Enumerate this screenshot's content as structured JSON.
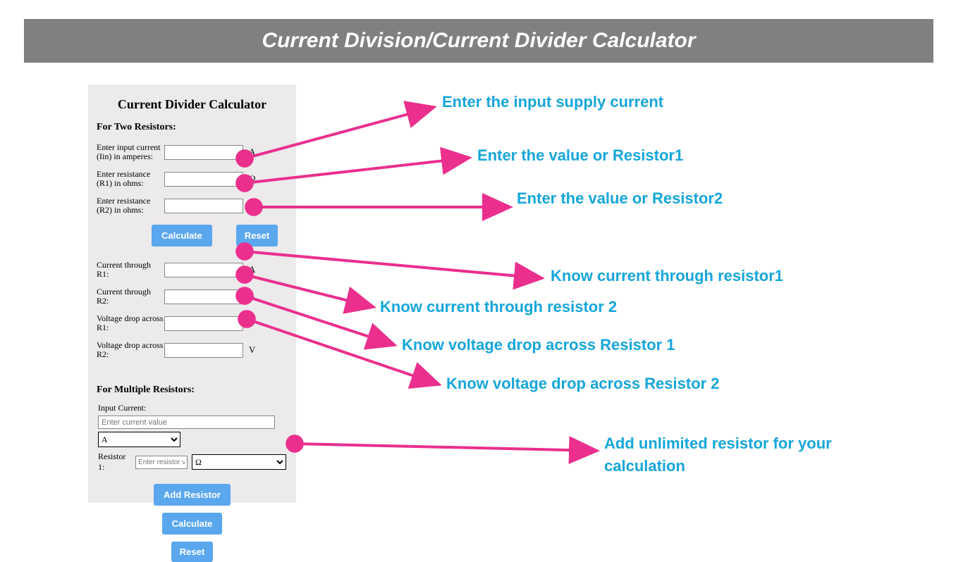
{
  "banner_title": "Current Division/Current Divider Calculator",
  "panel": {
    "title": "Current Divider Calculator",
    "two_section": "For Two Resistors:",
    "rows": [
      {
        "label": "Enter input current (Iin) in amperes:",
        "unit": "A",
        "value": ""
      },
      {
        "label": "Enter resistance (R1) in ohms:",
        "unit": "Ω",
        "value": ""
      },
      {
        "label": "Enter resistance (R2) in ohms:",
        "unit": "Ω",
        "value": ""
      }
    ],
    "calculate": "Calculate",
    "reset": "Reset",
    "outs": [
      {
        "label": "Current through R1:",
        "unit": "A",
        "value": ""
      },
      {
        "label": "Current through R2:",
        "unit": "A",
        "value": ""
      },
      {
        "label": "Voltage drop across R1:",
        "unit": "V",
        "value": ""
      },
      {
        "label": "Voltage drop across R2:",
        "unit": "V",
        "value": ""
      }
    ],
    "multi_section": "For Multiple Resistors:",
    "multi": {
      "input_label": "Input Current:",
      "input_placeholder": "Enter current value",
      "unit_selected": "A",
      "r1_label": "Resistor 1:",
      "r1_placeholder": "Enter resistor va",
      "r1_unit": "Ω",
      "add": "Add Resistor",
      "calculate": "Calculate",
      "reset": "Reset"
    }
  },
  "annotations": {
    "a1": "Enter the input supply current",
    "a2": "Enter the value or Resistor1",
    "a3": "Enter the value or Resistor2",
    "a4": "Know current through resistor1",
    "a5": "Know current through resistor 2",
    "a6": "Know voltage drop across Resistor 1",
    "a7": "Know voltage drop across Resistor 2",
    "a8": "Add unlimited resistor for your",
    "a8b": "calculation"
  },
  "colors": {
    "accent": "#16a6d9",
    "arrow": "#ea2f8d",
    "button": "#5aa7ee",
    "banner": "#808080"
  }
}
